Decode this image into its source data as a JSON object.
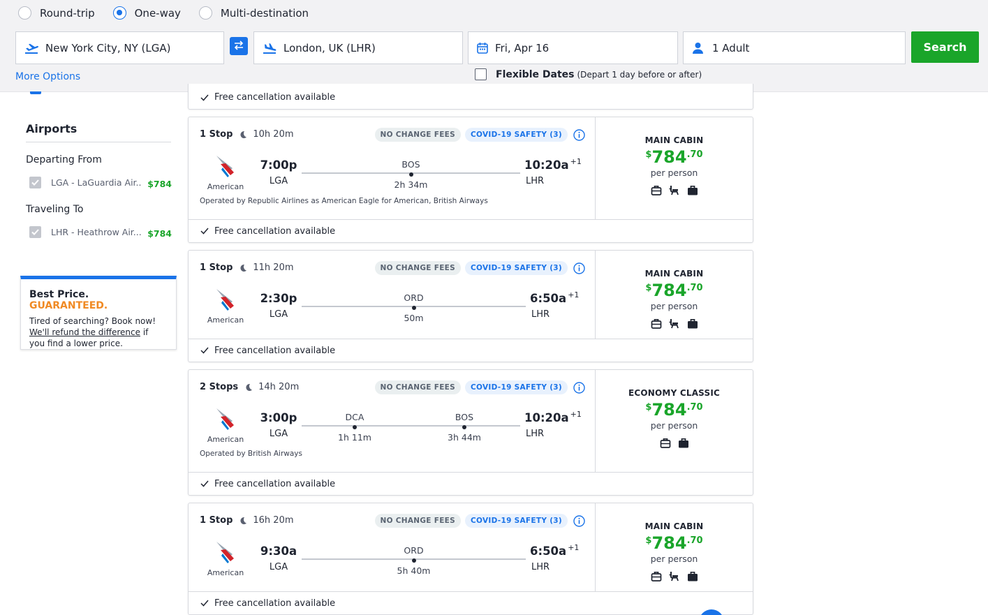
{
  "colors": {
    "accent": "#1a73e8",
    "price_green": "#1aa52a",
    "guarantee_orange": "#f08a24"
  },
  "search": {
    "trip_types": [
      {
        "label": "Round-trip",
        "selected": false
      },
      {
        "label": "One-way",
        "selected": true
      },
      {
        "label": "Multi-destination",
        "selected": false
      }
    ],
    "origin": "New York City, NY (LGA)",
    "destination": "London, UK (LHR)",
    "date": "Fri, Apr 16",
    "travelers": "1 Adult",
    "search_label": "Search",
    "more_options": "More Options",
    "flexible_label": "Flexible Dates",
    "flexible_sub": "(Depart 1 day before or after)",
    "icons": {
      "origin": "plane-takeoff-icon",
      "swap": "swap-icon",
      "destination": "plane-landing-icon",
      "date": "calendar-icon",
      "travelers": "person-icon"
    }
  },
  "sidebar": {
    "section_title": "Airports",
    "departing_label": "Departing From",
    "traveling_label": "Traveling To",
    "departing": {
      "name": "LGA - LaGuardia Air...",
      "price": "$784"
    },
    "arriving": {
      "name": "LHR - Heathrow Air...",
      "price": "$784"
    },
    "guarantee": {
      "title": "Best Price.",
      "title_highlight": "GUARANTEED.",
      "line1": "Tired of searching? Book now!",
      "link": "We'll refund the difference",
      "line2": "if",
      "line3": "you find a lower price."
    }
  },
  "top_partial_card": {
    "free_cancel": "Free cancellation available"
  },
  "results": [
    {
      "stops": "1 Stop",
      "duration": "10h 20m",
      "badge_no_change": "NO CHANGE FEES",
      "badge_covid": "COVID-19 SAFETY (3)",
      "airline": "American",
      "dep_time": "7:00p",
      "dep_code": "LGA",
      "arr_time": "10:20a",
      "arr_plus": "+1",
      "arr_code": "LHR",
      "layovers": [
        {
          "code": "BOS",
          "duration": "2h 34m"
        }
      ],
      "operated": "Operated by Republic Airlines as American Eagle for American, British Airways",
      "cabin": "MAIN CABIN",
      "currency": "$",
      "price": "784",
      "cents": ".70",
      "per_person": "per person",
      "amenities": [
        "carry-on-bag-icon",
        "seat-icon",
        "checked-bag-icon"
      ],
      "free_cancel": "Free cancellation available"
    },
    {
      "stops": "1 Stop",
      "duration": "11h 20m",
      "badge_no_change": "NO CHANGE FEES",
      "badge_covid": "COVID-19 SAFETY (3)",
      "airline": "American",
      "dep_time": "2:30p",
      "dep_code": "LGA",
      "arr_time": "6:50a",
      "arr_plus": "+1",
      "arr_code": "LHR",
      "layovers": [
        {
          "code": "ORD",
          "duration": "50m"
        }
      ],
      "operated": "",
      "cabin": "MAIN CABIN",
      "currency": "$",
      "price": "784",
      "cents": ".70",
      "per_person": "per person",
      "amenities": [
        "carry-on-bag-icon",
        "seat-icon",
        "checked-bag-icon"
      ],
      "free_cancel": "Free cancellation available"
    },
    {
      "stops": "2 Stops",
      "duration": "14h 20m",
      "badge_no_change": "NO CHANGE FEES",
      "badge_covid": "COVID-19 SAFETY (3)",
      "airline": "American",
      "dep_time": "3:00p",
      "dep_code": "LGA",
      "arr_time": "10:20a",
      "arr_plus": "+1",
      "arr_code": "LHR",
      "layovers": [
        {
          "code": "DCA",
          "duration": "1h 11m"
        },
        {
          "code": "BOS",
          "duration": "3h 44m"
        }
      ],
      "operated": "Operated by British Airways",
      "cabin": "ECONOMY CLASSIC",
      "currency": "$",
      "price": "784",
      "cents": ".70",
      "per_person": "per person",
      "amenities": [
        "carry-on-bag-icon",
        "checked-bag-icon"
      ],
      "free_cancel": "Free cancellation available"
    },
    {
      "stops": "1 Stop",
      "duration": "16h 20m",
      "badge_no_change": "NO CHANGE FEES",
      "badge_covid": "COVID-19 SAFETY (3)",
      "airline": "American",
      "dep_time": "9:30a",
      "dep_code": "LGA",
      "arr_time": "6:50a",
      "arr_plus": "+1",
      "arr_code": "LHR",
      "layovers": [
        {
          "code": "ORD",
          "duration": "5h 40m"
        }
      ],
      "operated": "",
      "cabin": "MAIN CABIN",
      "currency": "$",
      "price": "784",
      "cents": ".70",
      "per_person": "per person",
      "amenities": [
        "carry-on-bag-icon",
        "seat-icon",
        "checked-bag-icon"
      ],
      "free_cancel": "Free cancellation available"
    }
  ]
}
